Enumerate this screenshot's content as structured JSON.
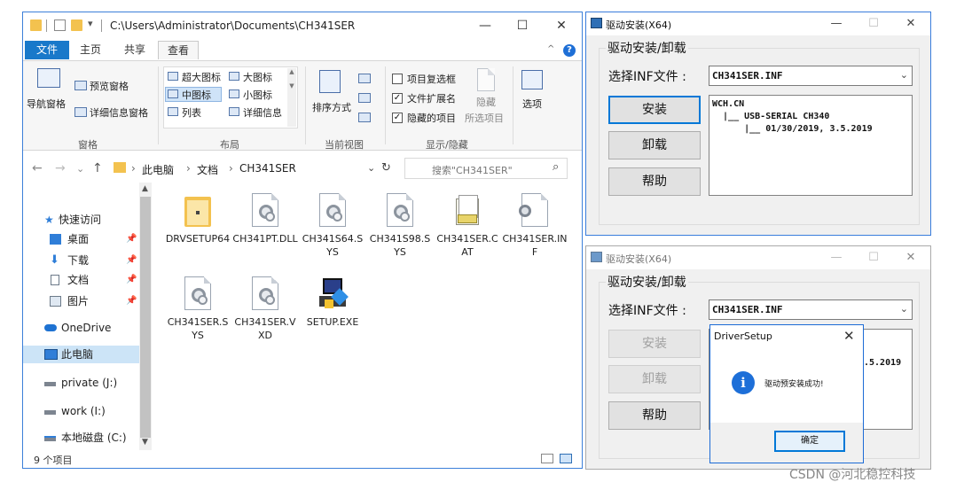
{
  "explorer": {
    "title_path": "C:\\Users\\Administrator\\Documents\\CH341SER",
    "qa_dropdown": "▾",
    "controls": {
      "minimize": "—",
      "maximize": "☐",
      "close": "✕"
    },
    "tabs": {
      "file": "文件",
      "home": "主页",
      "share": "共享",
      "view": "查看"
    },
    "ribbon": {
      "nav_pane": "导航窗格",
      "preview_pane": "预览窗格",
      "details_pane": "详细信息窗格",
      "group_panes": "窗格",
      "layout": {
        "xl_icons": "超大图标",
        "large_icons": "大图标",
        "medium_icons": "中图标",
        "small_icons": "小图标",
        "list": "列表",
        "details": "详细信息"
      },
      "group_layout": "布局",
      "sort_by": "排序方式",
      "group_current_view": "当前视图",
      "item_checkboxes": "项目复选框",
      "file_extensions": "文件扩展名",
      "hidden_items": "隐藏的项目",
      "hide": "隐藏",
      "selected_items": "所选项目",
      "options": "选项",
      "group_show_hide": "显示/隐藏"
    },
    "address": {
      "back": "←",
      "forward": "→",
      "recent": "⌄",
      "up": "↑",
      "crumbs": [
        "此电脑",
        "文档",
        "CH341SER"
      ],
      "separator": "›",
      "search_placeholder": "搜索\"CH341SER\""
    },
    "nav": {
      "quick_access": "快速访问",
      "desktop": "桌面",
      "downloads": "下载",
      "documents": "文档",
      "pictures": "图片",
      "onedrive": "OneDrive",
      "this_pc": "此电脑",
      "drive_j": "private (J:)",
      "drive_i": "work (I:)",
      "drive_c": "本地磁盘 (C:)"
    },
    "files": [
      {
        "name": "DRVSETUP64",
        "icon": "folder-icon"
      },
      {
        "name": "CH341PT.DLL",
        "icon": "gear-file-icon"
      },
      {
        "name": "CH341S64.SYS",
        "icon": "gear-file-icon"
      },
      {
        "name": "CH341S98.SYS",
        "icon": "gear-file-icon"
      },
      {
        "name": "CH341SER.CAT",
        "icon": "catalog-icon"
      },
      {
        "name": "CH341SER.INF",
        "icon": "inf-icon"
      },
      {
        "name": "CH341SER.SYS",
        "icon": "gear-file-icon"
      },
      {
        "name": "CH341SER.VXD",
        "icon": "gear-file-icon"
      },
      {
        "name": "SETUP.EXE",
        "icon": "setup-exe-icon"
      }
    ],
    "status": "9 个项目"
  },
  "driver_dialog_1": {
    "title": "驱动安装(X64)",
    "controls": {
      "minimize": "—",
      "maximize": "☐",
      "close": "✕"
    },
    "group": "驱动安装/卸载",
    "inf_label": "选择INF文件 :",
    "inf_value": "CH341SER.INF",
    "install": "安装",
    "uninstall": "卸载",
    "help": "帮助",
    "info_lines": [
      "WCH.CN",
      "  |__ USB-SERIAL CH340",
      "      |__ 01/30/2019, 3.5.2019"
    ]
  },
  "driver_dialog_2": {
    "title": "驱动安装(X64)",
    "controls": {
      "minimize": "—",
      "maximize": "☐",
      "close": "✕"
    },
    "group": "驱动安装/卸载",
    "inf_label": "选择INF文件 :",
    "inf_value": "CH341SER.INF",
    "install": "安装",
    "uninstall": "卸载",
    "help": "帮助",
    "info_partial": ".5.2019"
  },
  "message_box": {
    "title": "DriverSetup",
    "close": "✕",
    "message": "驱动预安装成功!",
    "ok": "确定"
  },
  "watermark": "CSDN @河北稳控科技"
}
